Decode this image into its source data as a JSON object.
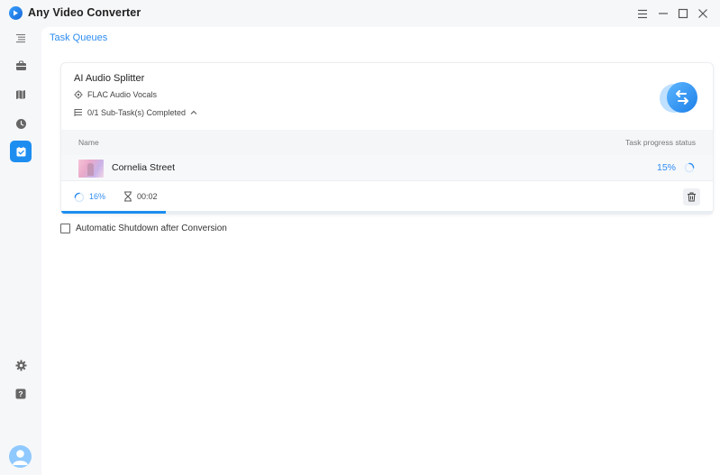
{
  "app": {
    "title": "Any Video Converter"
  },
  "header": {
    "tab_label": "Task Queues"
  },
  "task": {
    "title": "AI Audio Splitter",
    "format": "FLAC Audio Vocals",
    "subtasks": "0/1 Sub-Task(s) Completed",
    "columns": {
      "name": "Name",
      "status": "Task progress status"
    },
    "file": {
      "name": "Cornelia Street",
      "progress": "15%"
    },
    "overall_progress": "16%",
    "overall_progress_value": 0.16,
    "elapsed": "00:02"
  },
  "options": {
    "shutdown_label": "Automatic Shutdown after Conversion",
    "shutdown_checked": false
  },
  "colors": {
    "accent": "#2d8cf0",
    "active_nav": "#1d8ef0"
  },
  "icons": {
    "sidebar": [
      "menu-icon",
      "toolbox-icon",
      "library-icon",
      "history-icon",
      "task-queue-icon"
    ],
    "bottom": [
      "settings-icon",
      "help-icon",
      "user-avatar"
    ]
  }
}
